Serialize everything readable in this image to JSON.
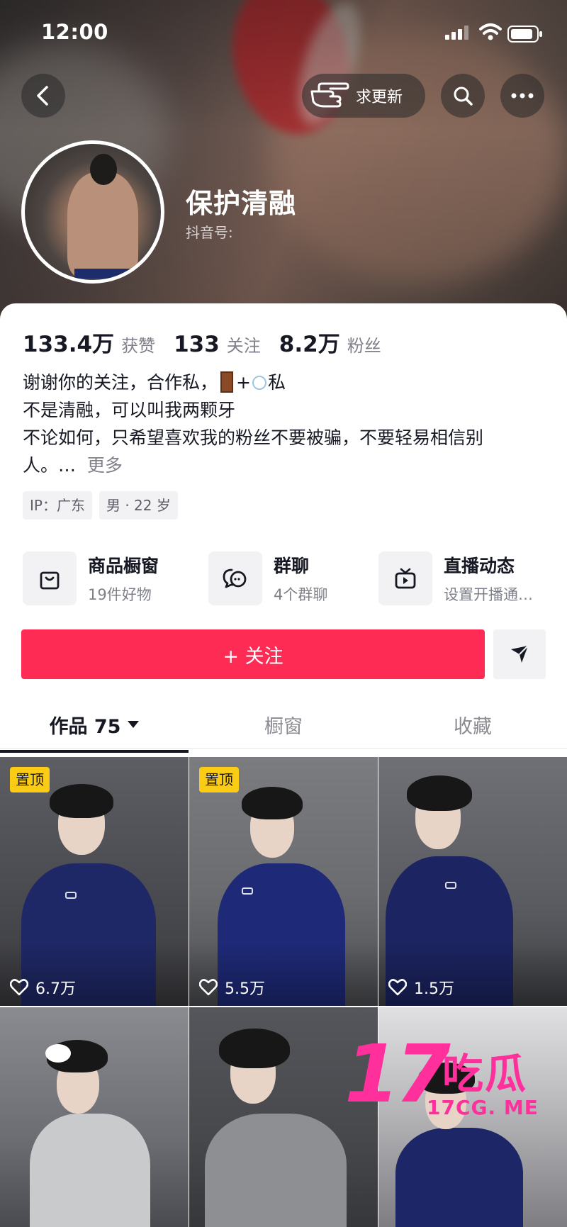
{
  "status_bar": {
    "time": "12:00"
  },
  "nav": {
    "request_update_label": "求更新"
  },
  "profile": {
    "name": "保护清融",
    "douyin_id_label": "抖音号:"
  },
  "stats": [
    {
      "value": "133.4万",
      "label": "获赞"
    },
    {
      "value": "133",
      "label": "关注"
    },
    {
      "value": "8.2万",
      "label": "粉丝"
    }
  ],
  "bio": {
    "line1_a": "谢谢你的关注，合作私，",
    "line1_b": "+",
    "line1_c": "私",
    "line2": "不是清融，可以叫我两颗牙",
    "line3": "不论如何，只希望喜欢我的粉丝不要被骗，不要轻易相信别",
    "line4": "人。…",
    "more": "更多"
  },
  "tags": [
    {
      "text": "IP：广东"
    },
    {
      "text": "男 · 22 岁"
    }
  ],
  "features": {
    "shop": {
      "title": "商品橱窗",
      "subtitle": "19件好物",
      "icon": "shopping-bag-icon"
    },
    "group": {
      "title": "群聊",
      "subtitle": "4个群聊",
      "icon": "chat-bubble-icon"
    },
    "live": {
      "title": "直播动态",
      "subtitle": "设置开播通…",
      "icon": "tv-icon"
    }
  },
  "actions": {
    "follow_label": "+ 关注"
  },
  "tabs": [
    {
      "label": "作品 75",
      "active": true
    },
    {
      "label": "橱窗",
      "active": false
    },
    {
      "label": "收藏",
      "active": false
    }
  ],
  "videos": [
    {
      "pinned": true,
      "pin_label": "置顶",
      "likes": "6.7万"
    },
    {
      "pinned": true,
      "pin_label": "置顶",
      "likes": "5.5万"
    },
    {
      "pinned": false,
      "likes": "1.5万"
    },
    {
      "pinned": false,
      "likes": ""
    },
    {
      "pinned": false,
      "likes": ""
    },
    {
      "pinned": false,
      "likes": ""
    }
  ],
  "watermark": {
    "number": "17",
    "chars": "吃瓜",
    "url": "17CG. ME"
  },
  "colors": {
    "accent": "#fe2c55",
    "pin_badge": "#facc15",
    "watermark": "#ff2f9b"
  }
}
